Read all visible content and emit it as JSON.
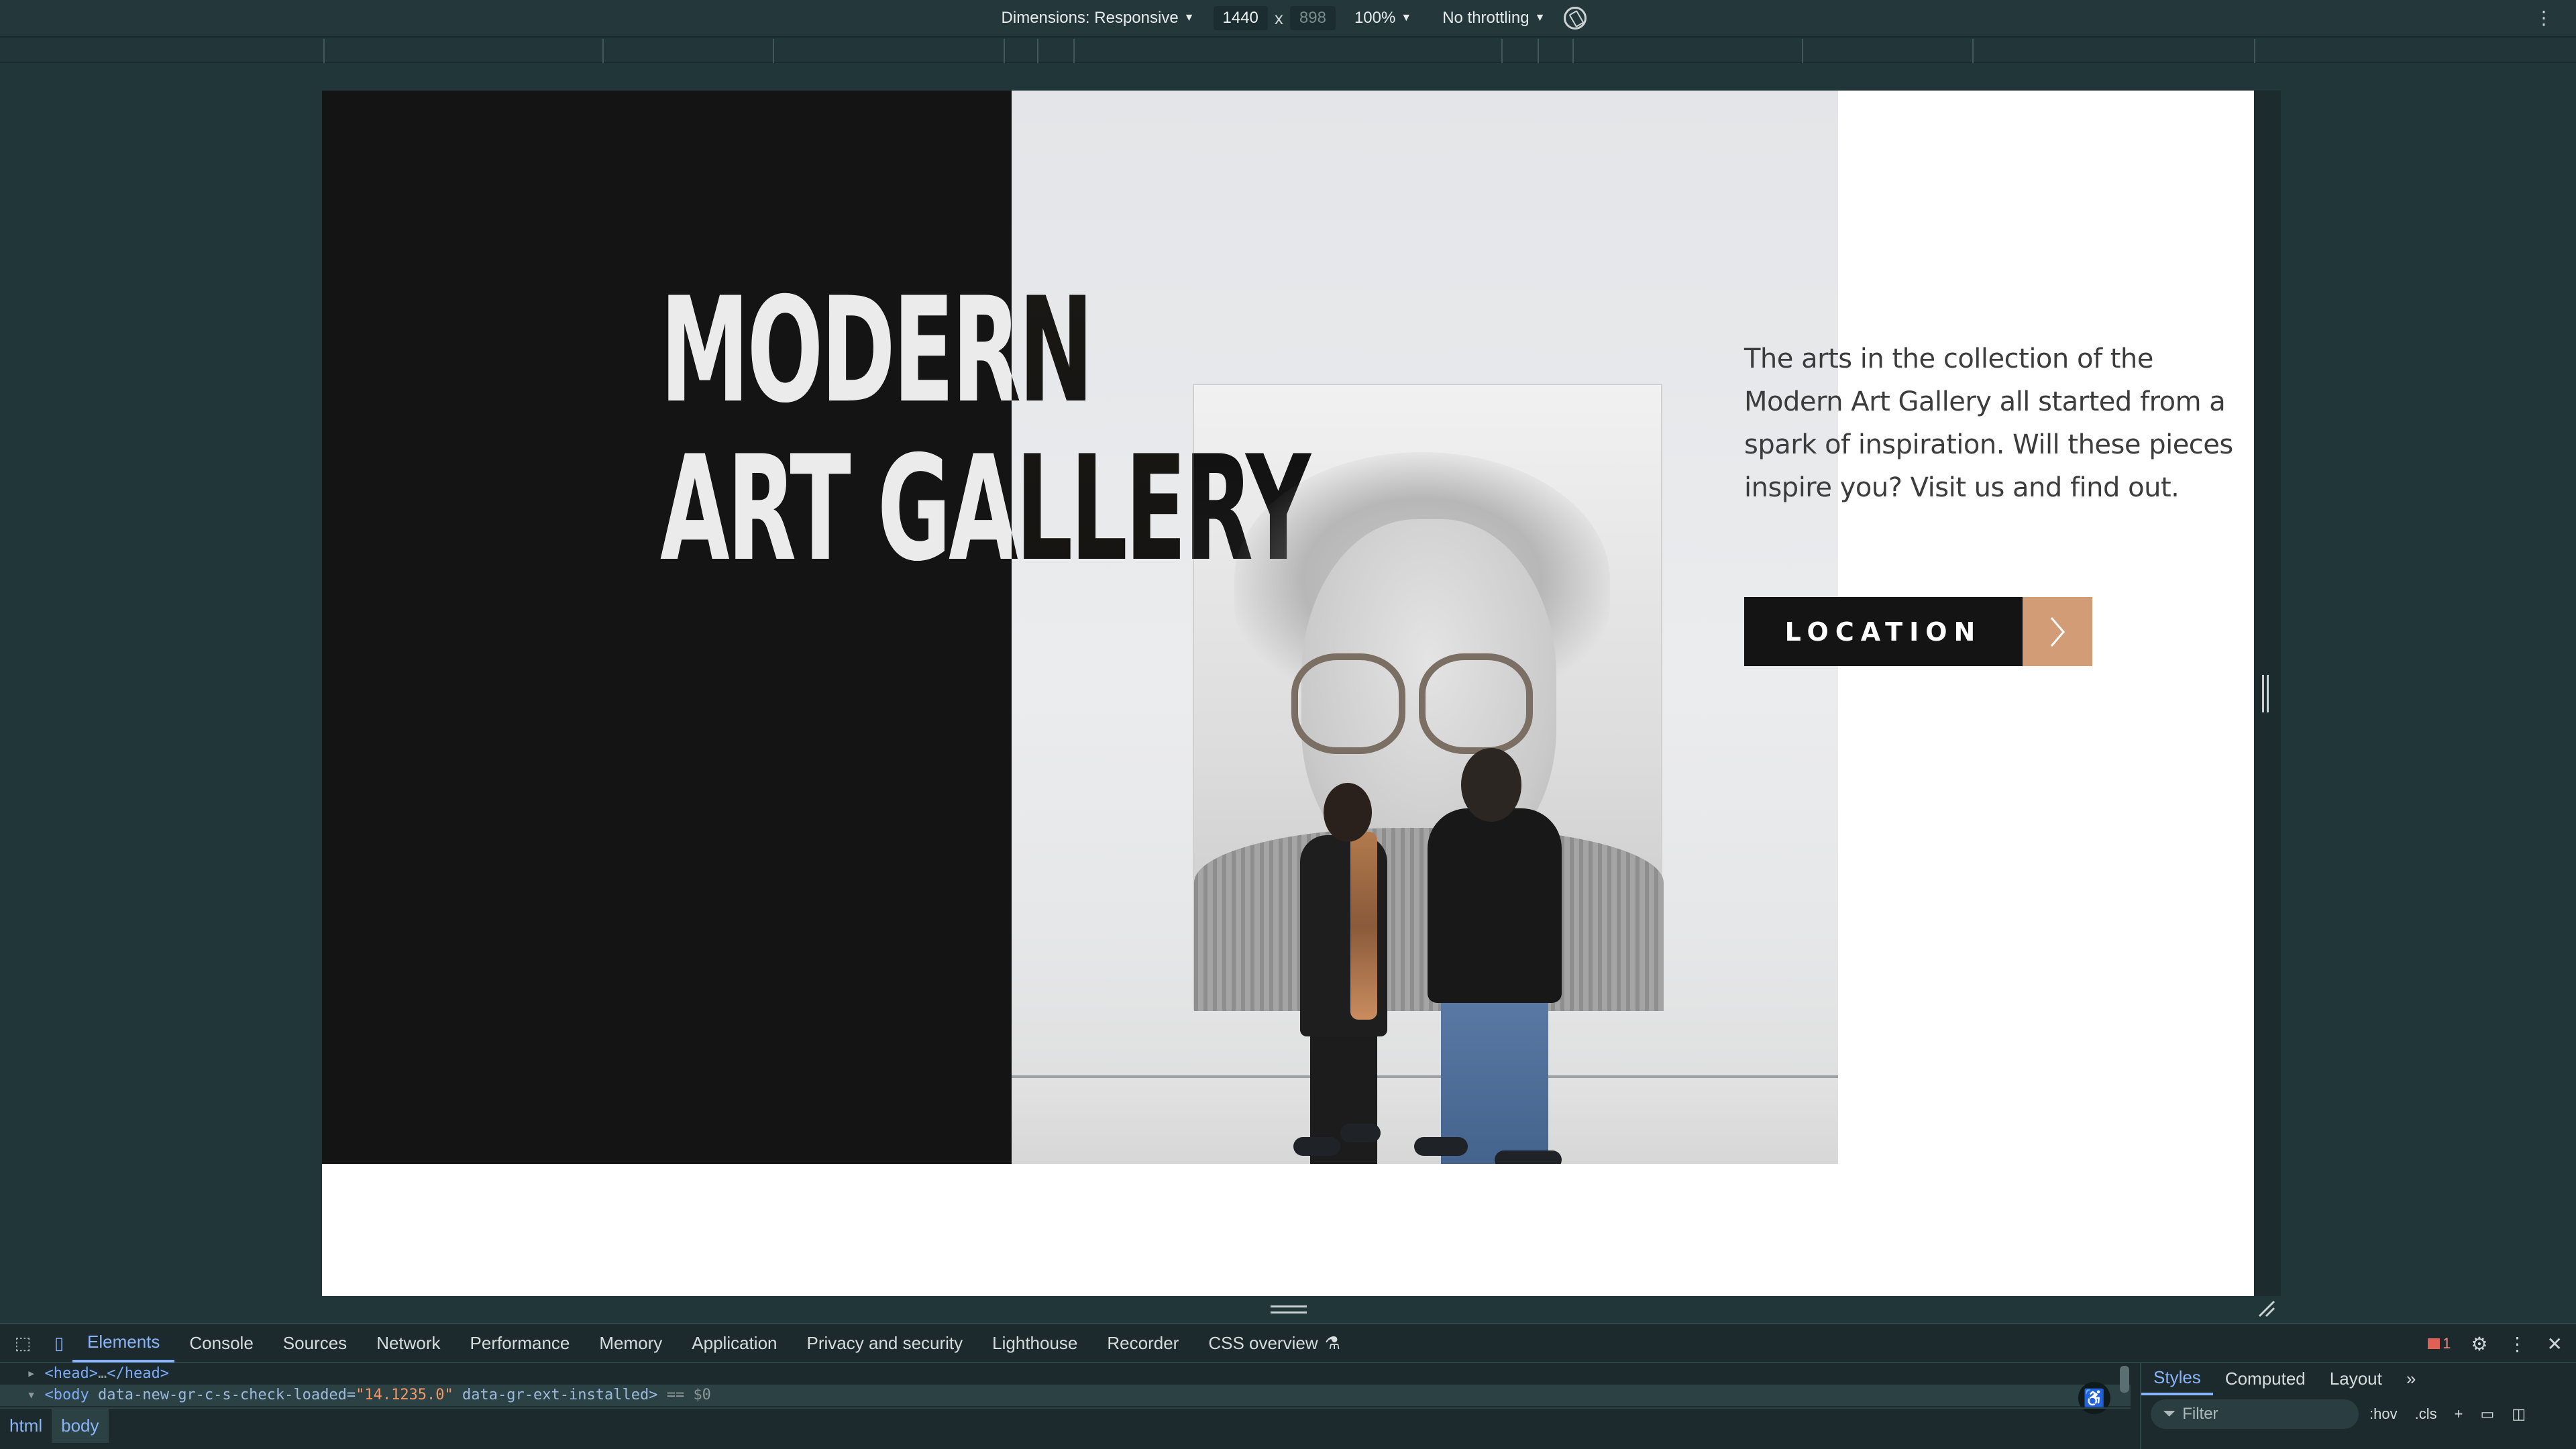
{
  "device_toolbar": {
    "dimensions_label": "Dimensions: Responsive",
    "width": "1440",
    "times": "x",
    "height_placeholder": "898",
    "zoom": "100%",
    "throttling": "No throttling",
    "icons": [
      "chevron-down-icon",
      "rotate-icon",
      "more-vert-icon"
    ]
  },
  "page": {
    "title_line1": "MODERN",
    "title_line2": "ART GALLERY",
    "description": "The arts in the collection of the Modern Art Gallery all started from a spark of inspiration. Will these pieces inspire you? Visit us and find out.",
    "location_label": "LOCATION",
    "colors": {
      "dark": "#141414",
      "accent": "#d19c76",
      "text": "#3c3c3c"
    }
  },
  "devtools": {
    "tabs": [
      "Elements",
      "Console",
      "Sources",
      "Network",
      "Performance",
      "Memory",
      "Application",
      "Privacy and security",
      "Lighthouse",
      "Recorder",
      "CSS overview"
    ],
    "active_tab": "Elements",
    "error_count": "1",
    "dom": {
      "head_line": "<head>",
      "head_close": "</head>",
      "body_tag": "<body",
      "body_attr1": "data-new-gr-c-s-check-loaded=",
      "body_val1": "\"14.1235.0\"",
      "body_attr2": "data-gr-ext-installed>",
      "body_eq": "== $0"
    },
    "breadcrumbs": [
      "html",
      "body"
    ],
    "styles_tabs": [
      "Styles",
      "Computed",
      "Layout"
    ],
    "styles_active": "Styles",
    "filter_placeholder": "Filter",
    "hov": ":hov",
    "cls": ".cls"
  }
}
